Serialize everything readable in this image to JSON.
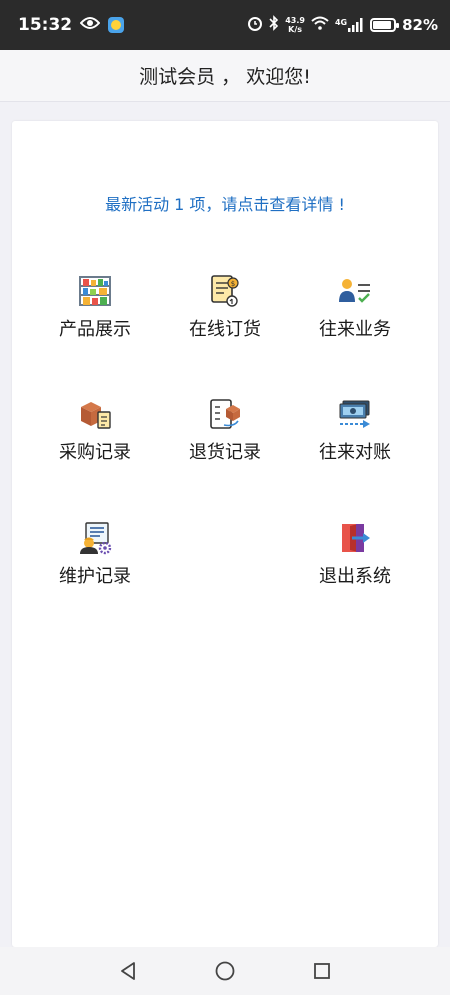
{
  "status_bar": {
    "time": "15:32",
    "net_speed_value": "43.9",
    "net_speed_unit": "K/s",
    "network_type": "4G",
    "battery": "82%"
  },
  "header": {
    "title": "测试会员 ， 欢迎您!"
  },
  "notice": "最新活动 1 项，请点击查看详情 !",
  "menu": {
    "product_display": "产品展示",
    "online_order": "在线订货",
    "business": "往来业务",
    "purchase_record": "采购记录",
    "return_record": "退货记录",
    "reconciliation": "往来对账",
    "maintenance_record": "维护记录",
    "logout": "退出系统"
  },
  "icons": {
    "product_display": "shelf-icon",
    "online_order": "order-document-icon",
    "business": "user-list-icon",
    "purchase_record": "box-clipboard-icon",
    "return_record": "return-box-icon",
    "reconciliation": "money-transfer-icon",
    "maintenance_record": "worker-gear-icon",
    "logout": "exit-door-icon"
  },
  "colors": {
    "notice_text": "#1f6fc3",
    "status_bar_bg": "#2b2b2b"
  }
}
